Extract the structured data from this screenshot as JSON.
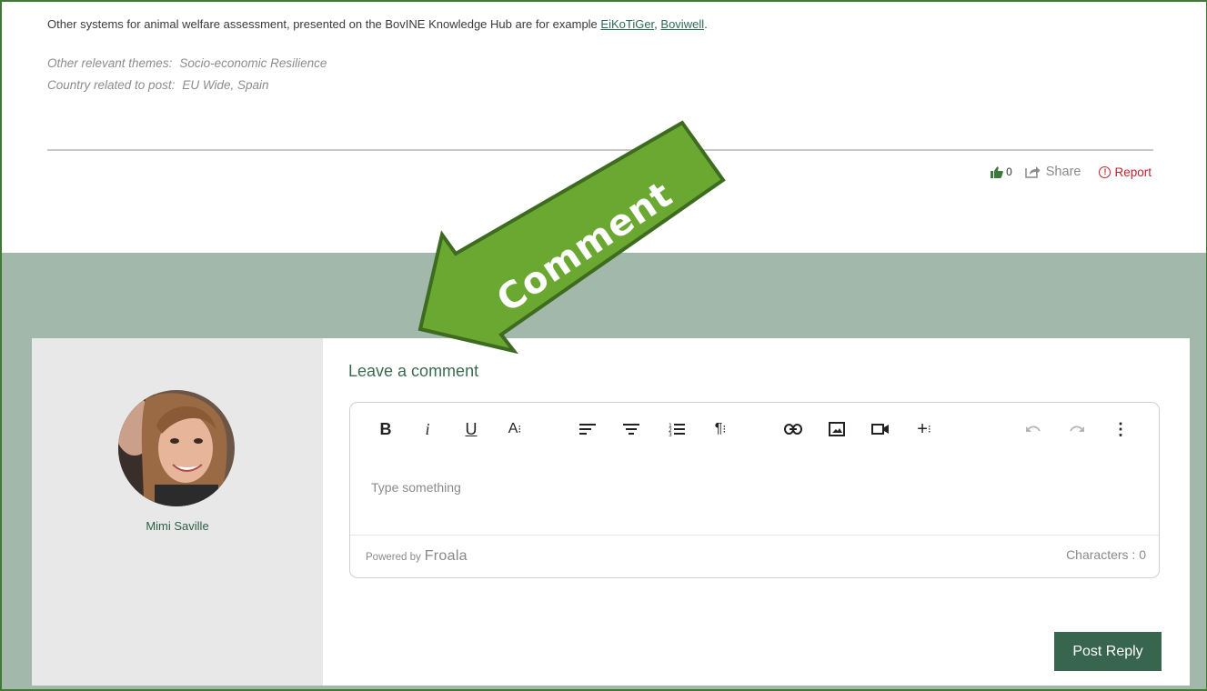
{
  "post": {
    "intro_text": "Other systems for animal welfare assessment, presented on the BovINE Knowledge Hub are for example ",
    "link1": "EiKoTiGer",
    "separator": ", ",
    "link2": "Boviwell",
    "intro_end": ".",
    "themes_label": "Other relevant themes:",
    "themes_value": "Socio-economic Resilience",
    "country_label": "Country related to post:",
    "country_value": "EU Wide, Spain"
  },
  "actions": {
    "like_count": "0",
    "share_label": "Share",
    "report_icon": "!",
    "report_label": "Report"
  },
  "annotation": {
    "label": "Comment",
    "color": "#6aa832"
  },
  "comment": {
    "user_name": "Mimi Saville",
    "title": "Leave a comment",
    "placeholder": "Type something",
    "powered_by": "Powered by",
    "powered_brand": "Froala",
    "characters": "Characters : 0",
    "submit_label": "Post Reply"
  },
  "toolbar_icons": [
    "bold-icon",
    "italic-icon",
    "underline-icon",
    "font-size-icon",
    "align-left-icon",
    "align-center-icon",
    "ordered-list-icon",
    "paragraph-format-icon",
    "link-icon",
    "image-icon",
    "video-icon",
    "more-insert-icon",
    "undo-icon",
    "redo-icon",
    "more-options-icon"
  ],
  "colors": {
    "brand_green": "#37654e",
    "band": "#a1b8ab",
    "report_red": "#c0232b"
  }
}
